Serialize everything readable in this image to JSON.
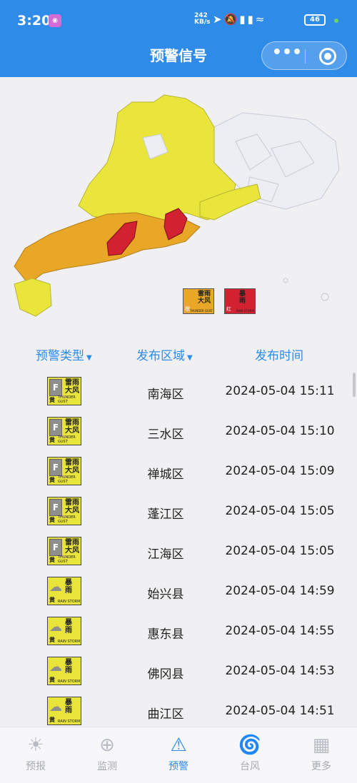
{
  "status_bar": {
    "time": "3:20",
    "net_speed_value": "242",
    "net_speed_unit": "KB/s",
    "battery": "46",
    "icons": [
      "location-icon",
      "mute-icon",
      "signal-icon",
      "signal-icon",
      "wifi-icon"
    ]
  },
  "header": {
    "title": "预警信号",
    "more_label": "•••",
    "close_icon": "target-icon"
  },
  "map": {
    "legend": [
      {
        "name": "雷雨\n大风",
        "level": "橙",
        "en": "THUNDER GUST",
        "color": "#e8a726"
      },
      {
        "name": "暴\n雨",
        "level": "红",
        "en": "RAIN STORM",
        "color": "#d22131"
      }
    ],
    "region_colors": {
      "yellow": "#e9e53a",
      "orange": "#e8a726",
      "red": "#d22131",
      "none": "#eceef3"
    }
  },
  "table": {
    "headers": {
      "type": "预警类型",
      "area": "发布区域",
      "time": "发布时间"
    },
    "rows": [
      {
        "kind": "thunder",
        "name": "雷雨\n大风",
        "level": "黄",
        "en": "THUNDER GUST",
        "region": "南海区",
        "time": "2024-05-04 15:11"
      },
      {
        "kind": "thunder",
        "name": "雷雨\n大风",
        "level": "黄",
        "en": "THUNDER GUST",
        "region": "三水区",
        "time": "2024-05-04 15:10"
      },
      {
        "kind": "thunder",
        "name": "雷雨\n大风",
        "level": "黄",
        "en": "THUNDER GUST",
        "region": "禅城区",
        "time": "2024-05-04 15:09"
      },
      {
        "kind": "thunder",
        "name": "雷雨\n大风",
        "level": "黄",
        "en": "THUNDER GUST",
        "region": "蓬江区",
        "time": "2024-05-04 15:05"
      },
      {
        "kind": "thunder",
        "name": "雷雨\n大风",
        "level": "黄",
        "en": "THUNDER GUST",
        "region": "江海区",
        "time": "2024-05-04 15:05"
      },
      {
        "kind": "rain",
        "name": "暴\n雨",
        "level": "黄",
        "en": "RAIN STORM",
        "region": "始兴县",
        "time": "2024-05-04 14:59"
      },
      {
        "kind": "rain",
        "name": "暴\n雨",
        "level": "黄",
        "en": "RAIN STORM",
        "region": "惠东县",
        "time": "2024-05-04 14:55"
      },
      {
        "kind": "rain",
        "name": "暴\n雨",
        "level": "黄",
        "en": "RAIN STORM",
        "region": "佛冈县",
        "time": "2024-05-04 14:53"
      },
      {
        "kind": "rain",
        "name": "暴\n雨",
        "level": "黄",
        "en": "RAIN STORM",
        "region": "曲江区",
        "time": "2024-05-04 14:51"
      }
    ]
  },
  "tabbar": {
    "items": [
      {
        "label": "预报",
        "icon": "weather-icon",
        "active": false
      },
      {
        "label": "监测",
        "icon": "radar-icon",
        "active": false
      },
      {
        "label": "预警",
        "icon": "warning-icon",
        "active": true
      },
      {
        "label": "台风",
        "icon": "typhoon-icon",
        "active": false
      },
      {
        "label": "更多",
        "icon": "grid-icon",
        "active": false
      }
    ]
  }
}
